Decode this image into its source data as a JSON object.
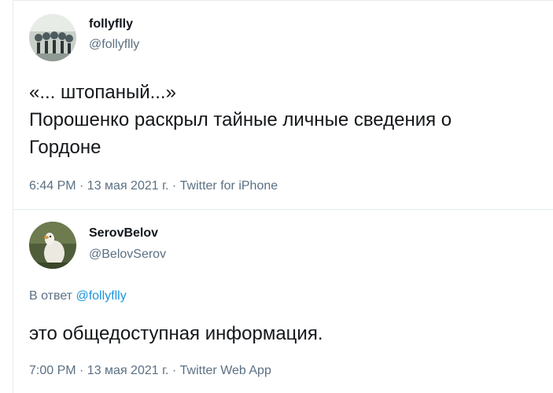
{
  "tweets": [
    {
      "display_name": "follyflly",
      "handle": "@follyflly",
      "lines": [
        "«... штопаный...»",
        "Порошенко раскрыл тайные личные сведения о",
        "Гордоне"
      ],
      "meta": "6:44 PM · 13 мая 2021 г. · Twitter for iPhone"
    },
    {
      "display_name": "SerovBelov",
      "handle": "@BelovSerov",
      "reply_prefix": "В ответ",
      "reply_to": "@follyflly",
      "text": "это общедоступная информация.",
      "meta": "7:00 PM · 13 мая 2021 г. · Twitter Web App"
    }
  ]
}
